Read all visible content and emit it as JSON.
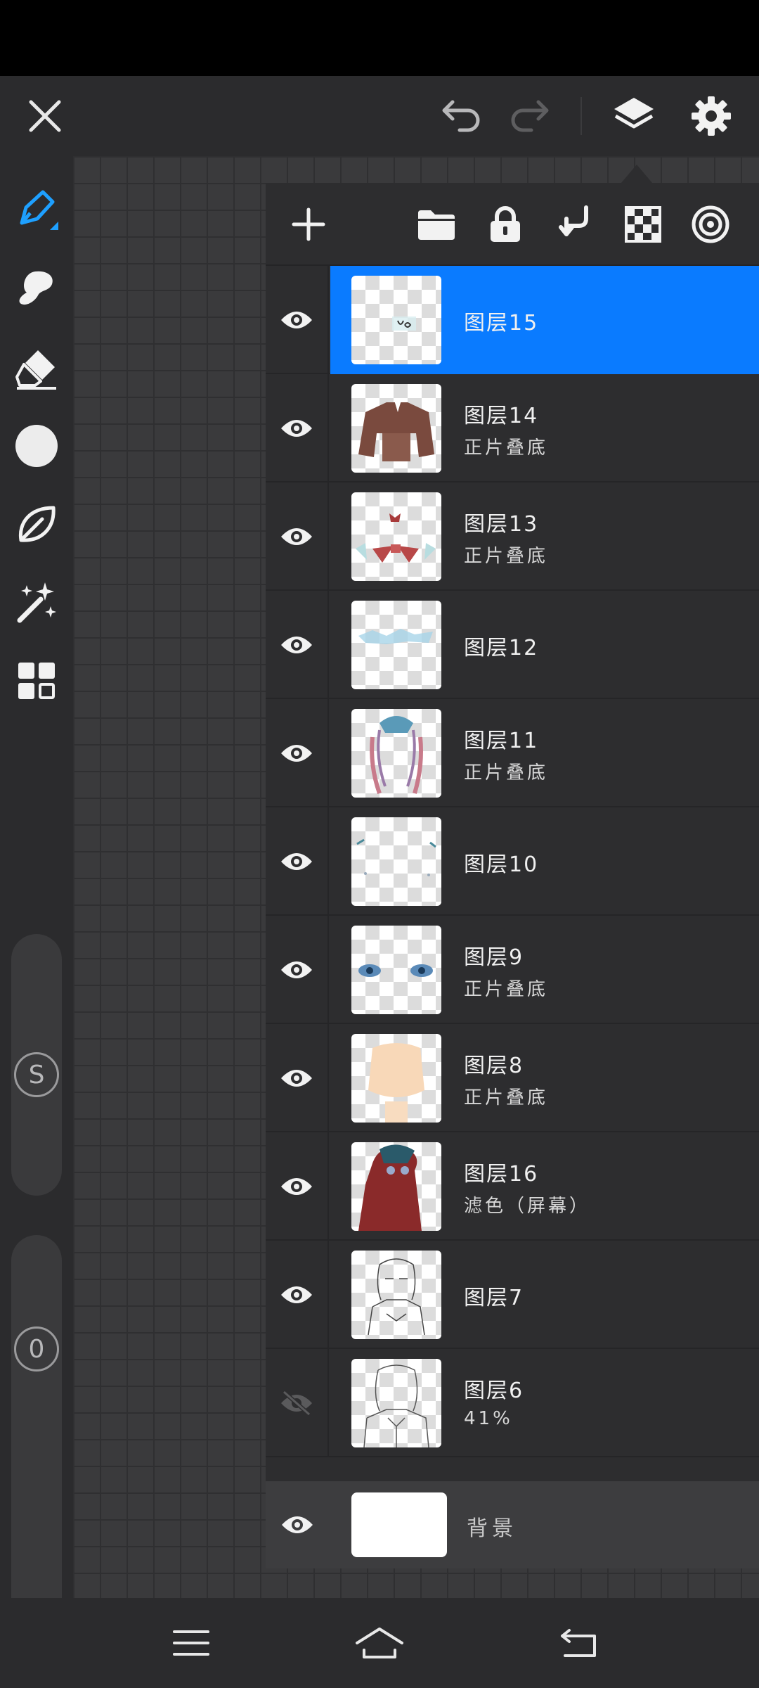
{
  "top_bar": {
    "icons": [
      "close-icon",
      "undo-icon",
      "redo-icon",
      "layers-icon",
      "gear-icon"
    ]
  },
  "left_toolbar": {
    "tools": [
      "pen-icon",
      "smudge-icon",
      "eraser-icon",
      "color-circle-icon",
      "lasso-leaf-icon",
      "magic-wand-icon",
      "grid-menu-icon"
    ],
    "size_slider_label": "S",
    "opacity_slider_label": "0",
    "accent_color": "#1ea0ff"
  },
  "layers_panel": {
    "toolbar_icons": [
      "plus-icon",
      "folder-icon",
      "lock-icon",
      "merge-down-icon",
      "checker-icon",
      "target-icon"
    ],
    "selected_color": "#0a7bff",
    "layers": [
      {
        "name": "图层15",
        "blend": "",
        "visible": true,
        "selected": true
      },
      {
        "name": "图层14",
        "blend": "正片叠底",
        "visible": true,
        "selected": false
      },
      {
        "name": "图层13",
        "blend": "正片叠底",
        "visible": true,
        "selected": false
      },
      {
        "name": "图层12",
        "blend": "",
        "visible": true,
        "selected": false
      },
      {
        "name": "图层11",
        "blend": "正片叠底",
        "visible": true,
        "selected": false
      },
      {
        "name": "图层10",
        "blend": "",
        "visible": true,
        "selected": false
      },
      {
        "name": "图层9",
        "blend": "正片叠底",
        "visible": true,
        "selected": false
      },
      {
        "name": "图层8",
        "blend": "正片叠底",
        "visible": true,
        "selected": false
      },
      {
        "name": "图层16",
        "blend": "滤色（屏幕）",
        "visible": true,
        "selected": false
      },
      {
        "name": "图层7",
        "blend": "",
        "visible": true,
        "selected": false
      },
      {
        "name": "图层6",
        "blend": "41%",
        "visible": false,
        "selected": false
      }
    ],
    "background": {
      "name": "背景",
      "visible": true
    }
  },
  "nav_bar": {
    "icons": [
      "menu-icon",
      "home-icon",
      "back-icon"
    ]
  }
}
